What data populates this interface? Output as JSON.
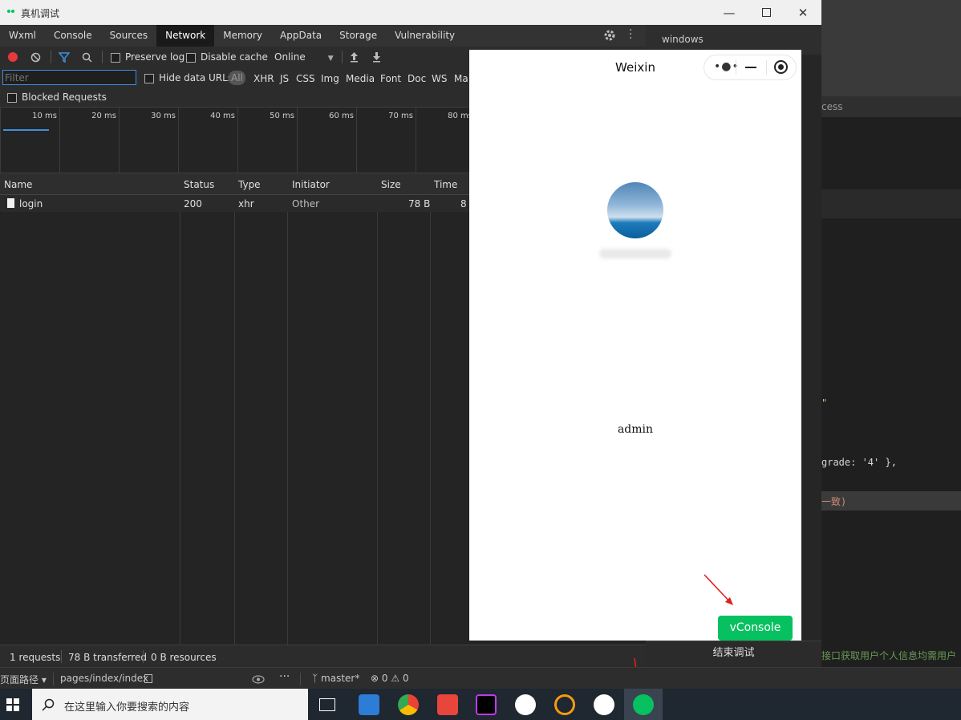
{
  "window": {
    "title": "真机调试"
  },
  "tabs": [
    {
      "label": "Wxml"
    },
    {
      "label": "Console"
    },
    {
      "label": "Sources"
    },
    {
      "label": "Network",
      "active": true
    },
    {
      "label": "Memory"
    },
    {
      "label": "AppData"
    },
    {
      "label": "Storage"
    },
    {
      "label": "Vulnerability"
    }
  ],
  "toolbar": {
    "preserve_log": "Preserve log",
    "disable_cache": "Disable cache",
    "throttle": "Online"
  },
  "filter": {
    "placeholder": "Filter",
    "hide_data_urls": "Hide data URLs",
    "types": [
      "All",
      "XHR",
      "JS",
      "CSS",
      "Img",
      "Media",
      "Font",
      "Doc",
      "WS",
      "Ma"
    ],
    "blocked_requests": "Blocked Requests"
  },
  "timeline": {
    "ticks": [
      "10 ms",
      "20 ms",
      "30 ms",
      "40 ms",
      "50 ms",
      "60 ms",
      "70 ms",
      "80 ms"
    ]
  },
  "table": {
    "columns": [
      "Name",
      "Status",
      "Type",
      "Initiator",
      "Size",
      "Time"
    ],
    "rows": [
      {
        "name": "login",
        "status": "200",
        "type": "xhr",
        "initiator": "Other",
        "size": "78 B",
        "time": "8"
      }
    ]
  },
  "status": {
    "requests": "1 requests",
    "transferred": "78 B transferred",
    "resources": "0 B resources"
  },
  "right_panel": {
    "header": "windows",
    "end_button": "结束调试"
  },
  "phone": {
    "title": "Weixin",
    "username": "admin",
    "vconsole": "vConsole"
  },
  "ide": {
    "page_path_label": "页面路径",
    "page_path": "pages/index/index",
    "branch": "master*",
    "errors": "0",
    "warnings": "0",
    "bg_label": "cess",
    "code1": "grade: '4' },",
    "code2": "一致)",
    "code3": "接口获取用户个人信息均需用户",
    "code_quote": "\""
  },
  "taskbar": {
    "search_placeholder": "在这里输入你要搜索的内容"
  },
  "colors": {
    "accent_green": "#07c160",
    "record_red": "#e5393b",
    "filter_blue": "#3e8de0"
  }
}
